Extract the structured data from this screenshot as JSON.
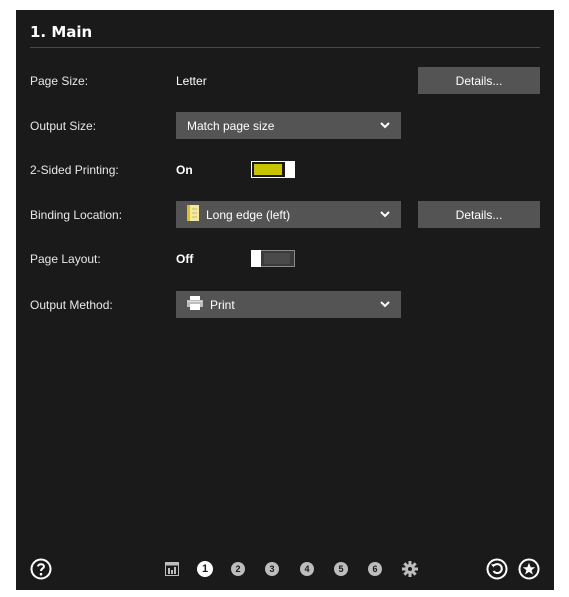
{
  "section_title": "1. Main",
  "rows": {
    "page_size": {
      "label": "Page Size:",
      "value": "Letter",
      "details": "Details..."
    },
    "output_size": {
      "label": "Output Size:",
      "value": "Match page size"
    },
    "two_sided": {
      "label": "2-Sided Printing:",
      "state": "On"
    },
    "binding": {
      "label": "Binding Location:",
      "value": "Long edge (left)",
      "details": "Details..."
    },
    "page_layout": {
      "label": "Page Layout:",
      "state": "Off"
    },
    "output_method": {
      "label": "Output Method:",
      "value": "Print"
    }
  },
  "footer": {
    "pages": [
      "1",
      "2",
      "3",
      "4",
      "5",
      "6"
    ],
    "active_page": "1",
    "icons": [
      "help-icon",
      "summary-icon",
      "settings-gear-icon",
      "reset-icon",
      "favorites-star-icon"
    ]
  },
  "colors": {
    "background": "#1a1a1a",
    "control": "#545454",
    "toggle_on": "#c9c400"
  }
}
